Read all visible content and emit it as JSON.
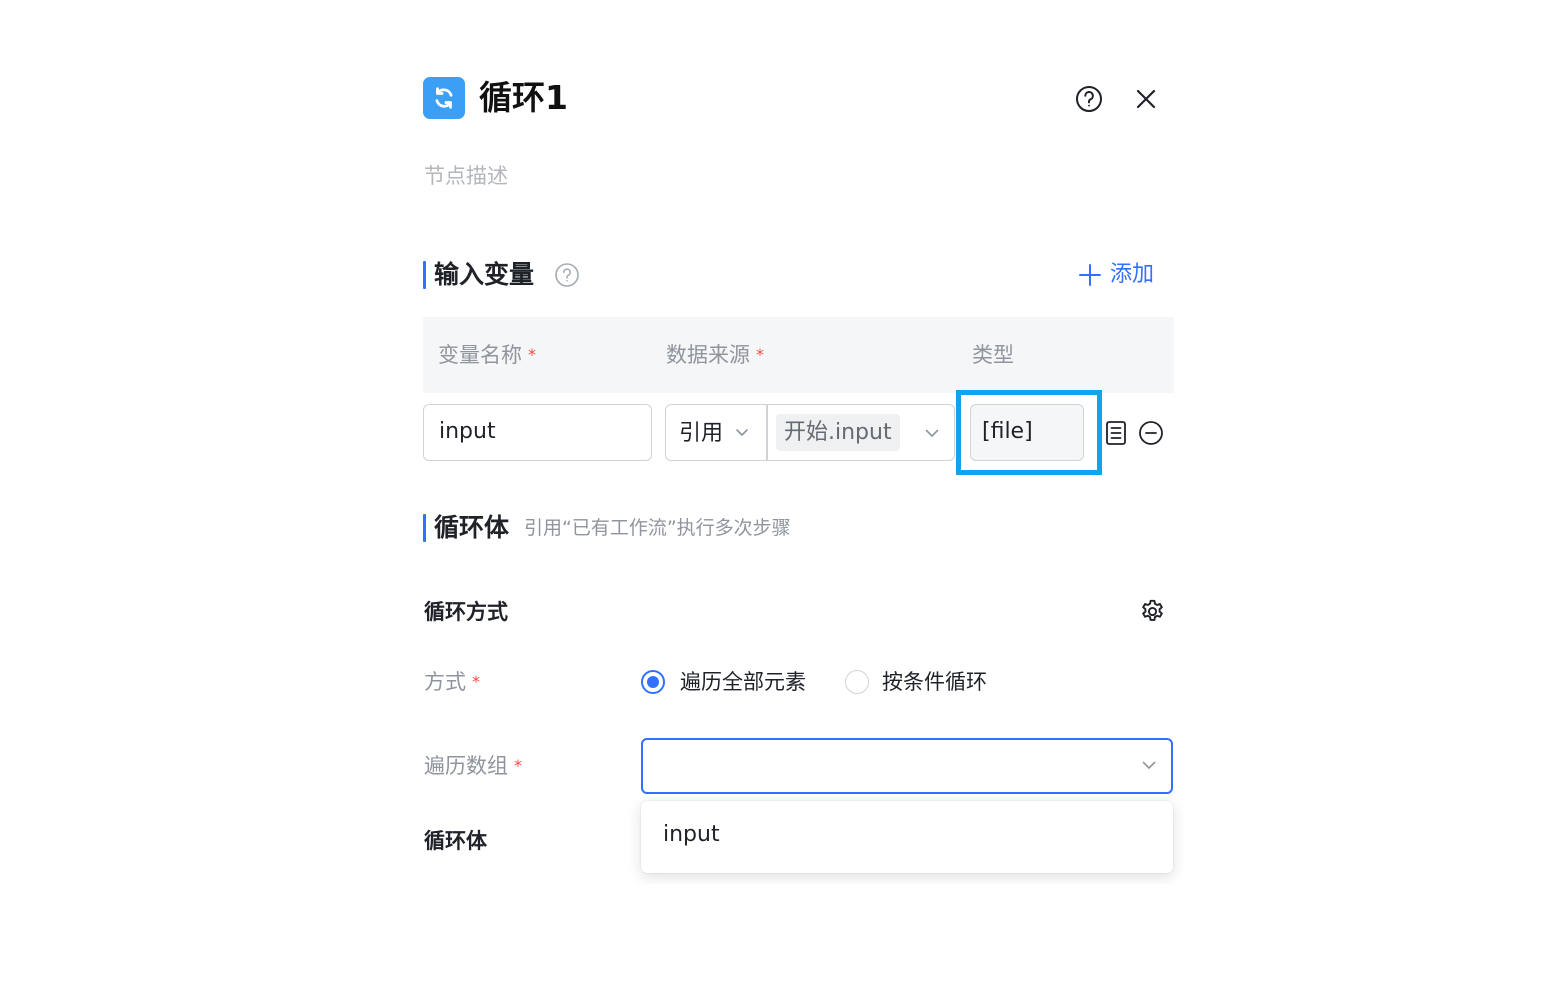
{
  "header": {
    "title": "循环1",
    "description_placeholder": "节点描述"
  },
  "input_section": {
    "title": "输入变量",
    "add_label": "添加",
    "columns": [
      {
        "label": "变量名称",
        "required": "*"
      },
      {
        "label": "数据来源",
        "required": "*"
      },
      {
        "label": "类型"
      }
    ],
    "rows": [
      {
        "name": "input",
        "source_mode": "引用",
        "source_value": "开始.input",
        "type": "[file]"
      }
    ]
  },
  "loop_body_section": {
    "title": "循环体",
    "subtitle": "引用“已有工作流”执行多次步骤"
  },
  "loop_mode": {
    "title": "循环方式",
    "mode_label": "方式",
    "required": "*",
    "options": [
      {
        "label": "遍历全部元素",
        "selected": true
      },
      {
        "label": "按条件循环",
        "selected": false
      }
    ],
    "array_label": "遍历数组",
    "array_value": "",
    "dropdown_options": [
      "input"
    ],
    "body_label": "循环体"
  },
  "colors": {
    "accent": "#3370ff",
    "highlight": "#12a3ec",
    "node_icon": "#3a9ff5",
    "required": "#f54a45"
  }
}
